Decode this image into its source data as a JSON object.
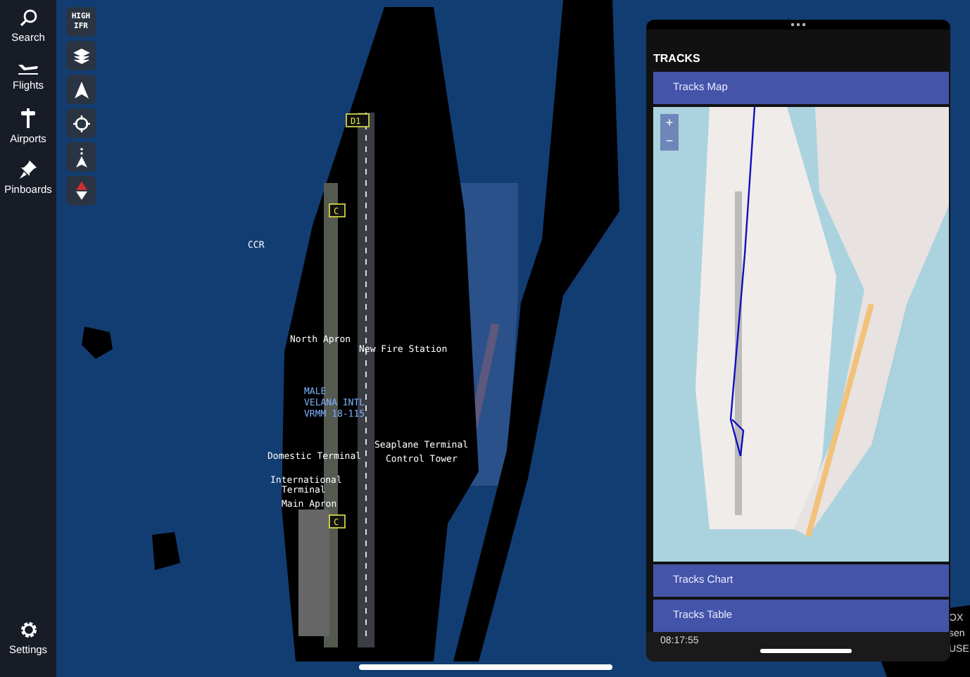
{
  "sidebar": {
    "items": [
      {
        "label": "Search",
        "selected": false
      },
      {
        "label": "Flights",
        "selected": false
      },
      {
        "label": "Airports",
        "selected": false
      },
      {
        "label": "Pinboards",
        "selected": false
      }
    ],
    "settings": {
      "label": "Settings"
    }
  },
  "map_toolbar": {
    "weather_button": {
      "lines": [
        "HIGH",
        "IFR"
      ]
    }
  },
  "map": {
    "taxiway_signs": [
      {
        "text": "D1"
      },
      {
        "text": "C"
      },
      {
        "text": "C"
      }
    ],
    "labels": [
      {
        "text": "CCR"
      },
      {
        "text": "North Apron"
      },
      {
        "text": "New Fire Station"
      },
      {
        "text": "MALE"
      },
      {
        "text": "VELANA INTL"
      },
      {
        "text": "VRMM 18-115"
      },
      {
        "text": "Seaplane Terminal"
      },
      {
        "text": "Domestic Terminal"
      },
      {
        "text": "Control Tower"
      },
      {
        "text": "International"
      },
      {
        "text": "Terminal"
      },
      {
        "text": "Main Apron"
      }
    ],
    "hidden_texts": [
      {
        "text": "OX"
      },
      {
        "text": "sen"
      },
      {
        "text": "USE"
      }
    ]
  },
  "panel": {
    "title": "TRACKS",
    "map_section": {
      "label": "Tracks Map"
    },
    "sections": [
      {
        "label": "Tracks Chart"
      },
      {
        "label": "Tracks Table"
      }
    ],
    "zoom_controls": [
      {
        "text": "+"
      },
      {
        "text": "−"
      }
    ],
    "footer_text": "08:17:55"
  }
}
